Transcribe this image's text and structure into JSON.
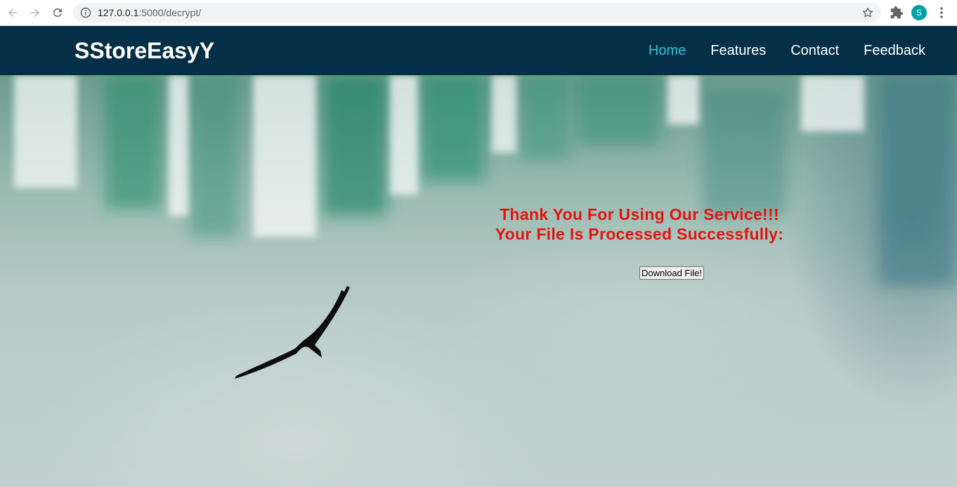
{
  "browser": {
    "url_host": "127.0.0.1",
    "url_path": ":5000/decrypt/",
    "avatar_letter": "S"
  },
  "site": {
    "brand": "SStoreEasyY",
    "nav": [
      {
        "label": "Home",
        "active": true
      },
      {
        "label": "Features",
        "active": false
      },
      {
        "label": "Contact",
        "active": false
      },
      {
        "label": "Feedback",
        "active": false
      }
    ]
  },
  "message": {
    "line1": "Thank You For Using Our Service!!!",
    "line2": "Your File Is Processed Successfully:",
    "download_label": "Download File!"
  },
  "colors": {
    "navbar_bg": "#052f46",
    "active_link": "#2fc4d6",
    "message_text": "#e3140f"
  },
  "icons": {
    "back": "arrow-left-icon",
    "forward": "arrow-right-icon",
    "reload": "reload-icon",
    "site_info": "info-icon",
    "bookmark": "star-icon",
    "extensions": "puzzle-icon",
    "menu": "kebab-icon"
  }
}
